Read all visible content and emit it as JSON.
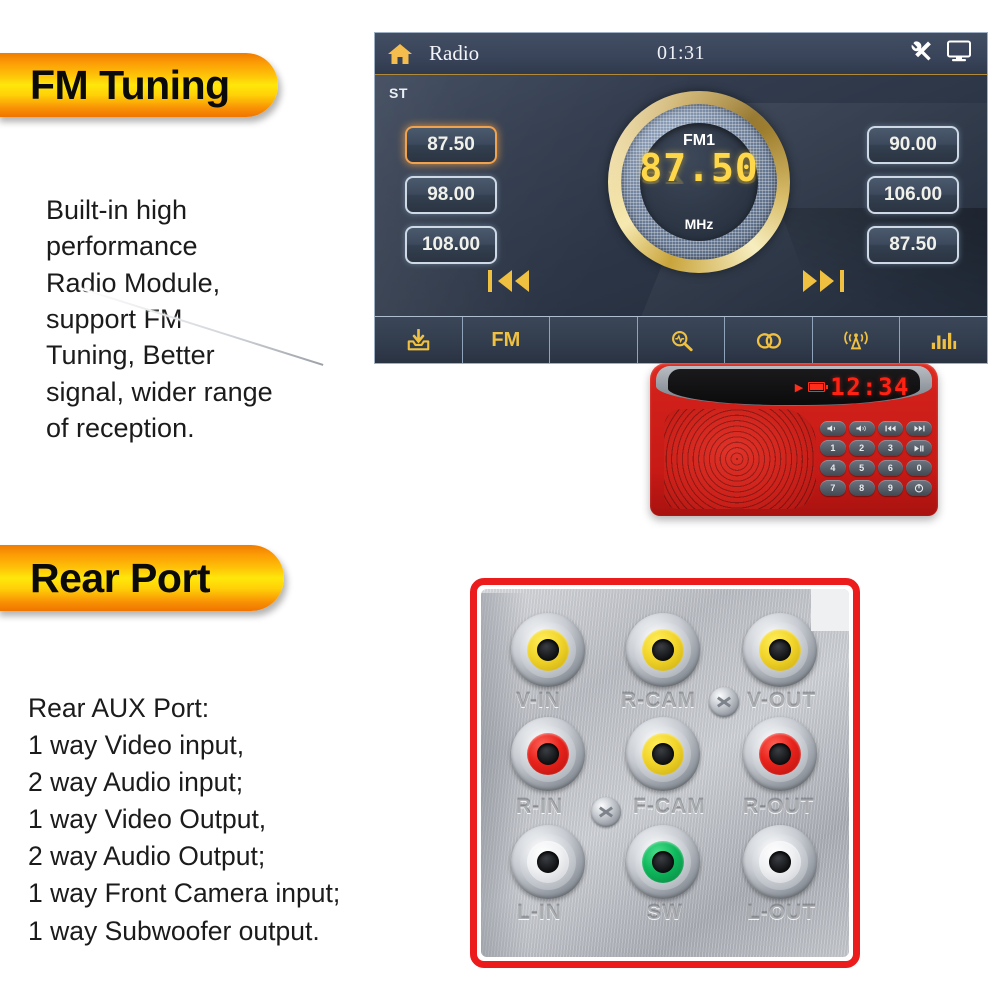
{
  "sections": {
    "fm": {
      "badge_label": "FM Tuning",
      "description": "Built-in high\nperformance\nRadio Module,\nsupport FM\nTuning, Better\nsignal, wider range\nof reception."
    },
    "rear": {
      "badge_label": "Rear Port",
      "description": "Rear AUX Port:\n1 way Video input,\n2 way Audio input;\n1 way Video Output,\n2 way Audio Output;\n1 way Front Camera input;\n1 way Subwoofer output."
    }
  },
  "radio_screen": {
    "topbar": {
      "home_icon": "home-icon",
      "title": "Radio",
      "clock": "01:31",
      "settings_icon": "tools-wrench-icon",
      "display_icon": "monitor-icon"
    },
    "stereo_indicator": "ST",
    "dial": {
      "band": "FM1",
      "frequency": "87.50",
      "unit": "MHz"
    },
    "seek": {
      "prev": "|≪",
      "next": "≫|"
    },
    "presets_left": [
      "87.50",
      "98.00",
      "108.00"
    ],
    "presets_right": [
      "90.00",
      "106.00",
      "87.50"
    ],
    "active_preset": "87.50",
    "toolbar": [
      {
        "name": "save-preset-icon",
        "glyph": "⤓",
        "label": ""
      },
      {
        "name": "band-fm-button",
        "glyph": "",
        "label": "FM"
      },
      {
        "name": "empty-cell",
        "glyph": "",
        "label": ""
      },
      {
        "name": "scan-search-icon",
        "glyph": "⚲",
        "label": ""
      },
      {
        "name": "loop-repeat-icon",
        "glyph": "∞",
        "label": ""
      },
      {
        "name": "antenna-broadcast-icon",
        "glyph": "\u0001",
        "label": ""
      },
      {
        "name": "equalizer-icon",
        "glyph": "‖",
        "label": ""
      }
    ],
    "colors": {
      "accent": "#f0c040",
      "screen_bg": "#2f3a4c",
      "active_border": "#f0a24e"
    }
  },
  "portable_radio": {
    "lcd": {
      "play_glyph": "▶",
      "battery_icon": "battery-icon",
      "time": "12:34"
    },
    "keys": [
      [
        "🔉",
        "🔊",
        "⏮",
        "⏭"
      ],
      [
        "1",
        "2",
        "3",
        "⏯"
      ],
      [
        "4",
        "5",
        "6",
        "0"
      ],
      [
        "7",
        "8",
        "9",
        "⏻"
      ]
    ],
    "body_color": "#cc1f18"
  },
  "port_panel": {
    "border_color": "#ec1c1c",
    "jacks": [
      {
        "label": "V-IN",
        "color": "yellow"
      },
      {
        "label": "R-CAM",
        "color": "yellow"
      },
      {
        "label": "V-OUT",
        "color": "yellow"
      },
      {
        "label": "R-IN",
        "color": "red"
      },
      {
        "label": "F-CAM",
        "color": "yellow"
      },
      {
        "label": "R-OUT",
        "color": "red"
      },
      {
        "label": "L-IN",
        "color": "white"
      },
      {
        "label": "SW",
        "color": "green"
      },
      {
        "label": "L-OUT",
        "color": "white"
      }
    ]
  }
}
